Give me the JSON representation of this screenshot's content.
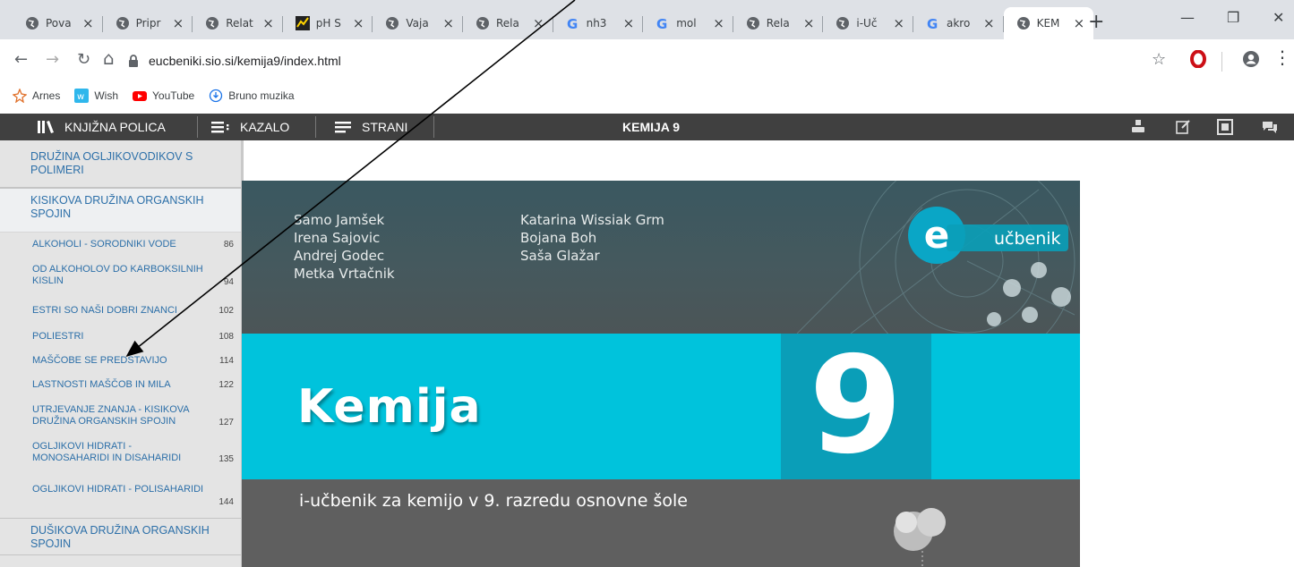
{
  "browser": {
    "tabs": [
      {
        "title": "Pova",
        "icon": "globe-icon"
      },
      {
        "title": "Pripr",
        "icon": "globe-icon"
      },
      {
        "title": "Relat",
        "icon": "globe-icon"
      },
      {
        "title": "pH S",
        "icon": "pmet-icon"
      },
      {
        "title": "Vaja",
        "icon": "globe-icon"
      },
      {
        "title": "Rela",
        "icon": "globe-icon"
      },
      {
        "title": "nh3",
        "icon": "google-icon"
      },
      {
        "title": "mol",
        "icon": "google-icon"
      },
      {
        "title": "Rela",
        "icon": "globe-icon"
      },
      {
        "title": "i-Uč",
        "icon": "globe-icon"
      },
      {
        "title": "akro",
        "icon": "google-icon"
      },
      {
        "title": "KEM",
        "icon": "globe-icon",
        "active": true
      }
    ],
    "close_glyph": "×",
    "new_tab_glyph": "+",
    "window": {
      "minimize": "—",
      "maximize": "❐",
      "close": "✕"
    },
    "nav": {
      "back": "←",
      "forward": "→",
      "reload": "↻",
      "home": "⌂"
    },
    "url": "eucbeniki.sio.si/kemija9/index.html",
    "star": "☆",
    "menu": "⋮",
    "bookmarks": [
      {
        "label": "Arnes",
        "icon": "arnes-icon"
      },
      {
        "label": "Wish",
        "icon": "wish-icon"
      },
      {
        "label": "YouTube",
        "icon": "youtube-icon"
      },
      {
        "label": "Bruno muzika",
        "icon": "cloud-icon"
      }
    ]
  },
  "appbar": {
    "bookshelf": "KNJIŽNA POLICA",
    "index": "KAZALO",
    "pages": "STRANI",
    "title": "KEMIJA 9"
  },
  "sidebar": {
    "sections": [
      {
        "label": "DRUŽINA OGLJIKOVODIKOV S POLIMERI"
      },
      {
        "label": "KISIKOVA DRUŽINA ORGANSKIH SPOJIN"
      },
      {
        "label": "DUŠIKOVA DRUŽINA ORGANSKIH SPOJIN"
      }
    ],
    "items": [
      {
        "label": "ALKOHOLI - SORODNIKI VODE",
        "page": "86"
      },
      {
        "label": "OD ALKOHOLOV DO KARBOKSILNIH KISLIN",
        "page": "94"
      },
      {
        "label": "ESTRI SO NAŠI DOBRI ZNANCI",
        "page": "102"
      },
      {
        "label": "POLIESTRI",
        "page": "108"
      },
      {
        "label": "MAŠČOBE SE PREDSTAVIJO",
        "page": "114"
      },
      {
        "label": "LASTNOSTI MAŠČOB IN MILA",
        "page": "122"
      },
      {
        "label": "UTRJEVANJE ZNANJA - KISIKOVA DRUŽINA ORGANSKIH SPOJIN",
        "page": "127"
      },
      {
        "label": "OGLJIKOVI HIDRATI - MONOSAHARIDI IN DISAHARIDI",
        "page": "135"
      },
      {
        "label": "OGLJIKOVI HIDRATI - POLISAHARIDI",
        "page": "144"
      }
    ]
  },
  "cover": {
    "authors_left": [
      "Samo Jamšek",
      "Irena Sajovic",
      "Andrej Godec",
      "Metka Vrtačnik"
    ],
    "authors_right": [
      "Katarina Wissiak Grm",
      "Bojana Boh",
      "Saša Glažar"
    ],
    "logo_text": "učbenik",
    "logo_letter": "e",
    "title": "Kemija",
    "grade": "9",
    "subtitle": "i-učbenik za kemijo v 9. razredu osnovne šole"
  },
  "colors": {
    "accent": "#00c3dc",
    "accent_dark": "#0a9eb8",
    "appbar": "#404040",
    "link": "#2c6fa8"
  }
}
